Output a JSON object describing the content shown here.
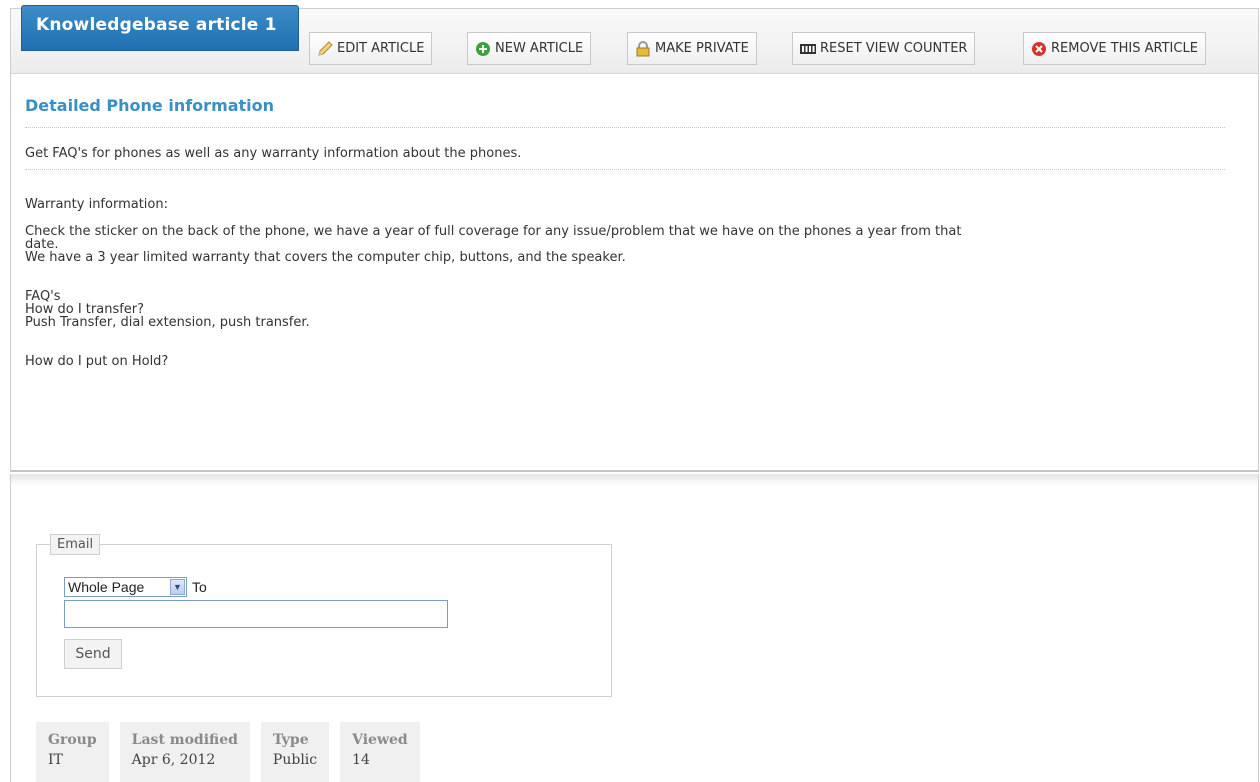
{
  "header": {
    "title": "Knowledgebase article 1"
  },
  "toolbar": {
    "buttons": [
      {
        "label": "EDIT ARTICLE",
        "icon": "pencil-icon"
      },
      {
        "label": "NEW ARTICLE",
        "icon": "add-circle-icon"
      },
      {
        "label": "MAKE PRIVATE",
        "icon": "padlock-icon"
      },
      {
        "label": "RESET VIEW COUNTER",
        "icon": "counter-icon"
      },
      {
        "label": "REMOVE THIS ARTICLE",
        "icon": "remove-circle-icon"
      }
    ]
  },
  "article": {
    "headline": "Detailed Phone information",
    "summary": "Get FAQ's for phones as well as any warranty information about the phones.",
    "body": {
      "warranty_heading": "Warranty information:",
      "warranty_line_1": "Check the sticker on the back of the phone, we have a year of full coverage for any issue/problem that we have on the phones a year from that",
      "warranty_line_2": "date.",
      "warranty_line_3": "We have a 3 year limited warranty that covers the computer chip, buttons, and the speaker.",
      "faq_heading": "FAQ's",
      "faq_q1": "How do I transfer?",
      "faq_a1": "Push Transfer, dial extension, push transfer.",
      "faq_q2": "How do I put on Hold?"
    }
  },
  "email": {
    "legend": "Email",
    "scope_selected": "Whole Page",
    "to_label": "To",
    "to_value": "",
    "send_label": "Send"
  },
  "meta": [
    {
      "label": "Group",
      "value": "IT"
    },
    {
      "label": "Last modified",
      "value": "Apr 6, 2012"
    },
    {
      "label": "Type",
      "value": "Public"
    },
    {
      "label": "Viewed",
      "value": "14"
    }
  ],
  "colors": {
    "title_tab": "#2a7cbf",
    "headline": "#3990c4",
    "remove_icon": "#d9322b",
    "new_icon": "#3aa33a"
  }
}
